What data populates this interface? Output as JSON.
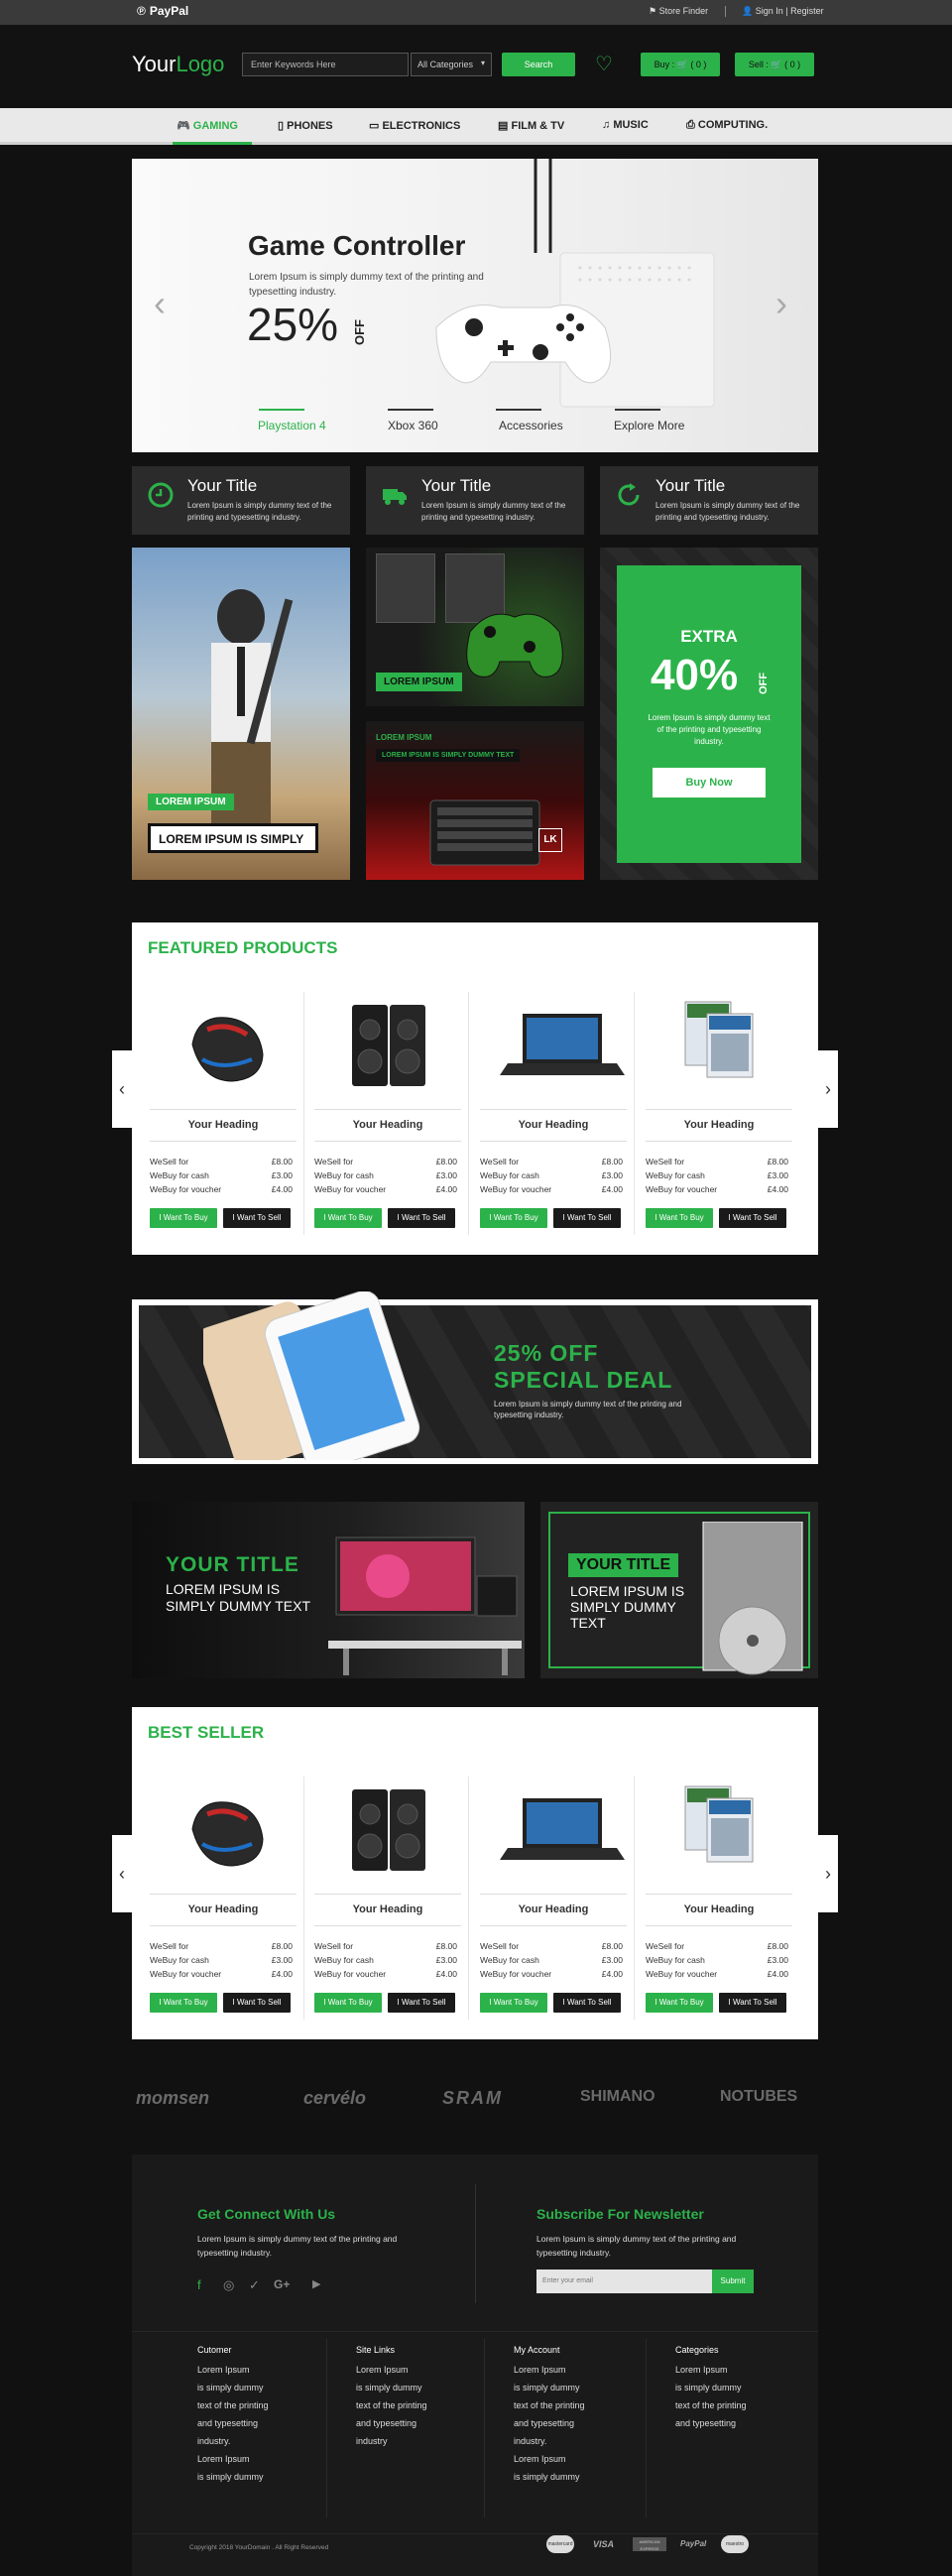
{
  "topbar": {
    "paypal": "PayPal",
    "store_finder": "Store Finder",
    "signin": "Sign In | Register"
  },
  "header": {
    "logo_a": "Your",
    "logo_b": "Logo",
    "search_placeholder": "Enter Keywords Here",
    "category": "All Categories",
    "search_btn": "Search",
    "buy_btn": "Buy : 🛒 ( 0 )",
    "sell_btn": "Sell : 🛒 ( 0 )"
  },
  "nav": {
    "items": [
      "GAMING",
      "PHONES",
      "ELECTRONICS",
      "FILM & TV",
      "MUSIC",
      "COMPUTING."
    ]
  },
  "hero": {
    "title": "Game Controller",
    "text": "Lorem Ipsum is simply dummy text of the printing and typesetting industry.",
    "percent": "25%",
    "off": "OFF",
    "tabs": [
      "Playstation 4",
      "Xbox 360",
      "Accessories",
      "Explore More"
    ]
  },
  "title_boxes": [
    {
      "title": "Your Title",
      "text": "Lorem Ipsum is simply dummy text of the printing and typesetting industry.",
      "icon": "clock-icon"
    },
    {
      "title": "Your Title",
      "text": "Lorem Ipsum is simply dummy text of the printing and typesetting industry.",
      "icon": "truck-icon"
    },
    {
      "title": "Your Title",
      "text": "Lorem Ipsum is simply dummy text of the printing and typesetting industry.",
      "icon": "refresh-icon"
    }
  ],
  "promo": {
    "pubg_tag": "LOREM IPSUM",
    "pubg_caption": "LOREM IPSUM IS SIMPLY",
    "ctrl_tag": "LOREM IPSUM",
    "kb_tag1": "LOREM IPSUM",
    "kb_tag2": "LOREM IPSUM IS SIMPLY DUMMY TEXT",
    "extra": "EXTRA",
    "extra_pct": "40%",
    "extra_off": "OFF",
    "extra_text": "Lorem Ipsum is simply dummy text of the printing and typesetting industry.",
    "buy_now": "Buy Now"
  },
  "featured": {
    "title": "FEATURED PRODUCTS",
    "products": [
      {
        "heading": "Your Heading",
        "rows": [
          [
            "WeSell for",
            "£8.00"
          ],
          [
            "WeBuy for cash",
            "£3.00"
          ],
          [
            "WeBuy for voucher",
            "£4.00"
          ]
        ],
        "buy": "I Want To Buy",
        "sell": "I Want To Sell",
        "img": "mouse"
      },
      {
        "heading": "Your Heading",
        "rows": [
          [
            "WeSell for",
            "£8.00"
          ],
          [
            "WeBuy for cash",
            "£3.00"
          ],
          [
            "WeBuy for voucher",
            "£4.00"
          ]
        ],
        "buy": "I Want To Buy",
        "sell": "I Want To Sell",
        "img": "speaker"
      },
      {
        "heading": "Your Heading",
        "rows": [
          [
            "WeSell for",
            "£8.00"
          ],
          [
            "WeBuy for cash",
            "£3.00"
          ],
          [
            "WeBuy for voucher",
            "£4.00"
          ]
        ],
        "buy": "I Want To Buy",
        "sell": "I Want To Sell",
        "img": "laptop"
      },
      {
        "heading": "Your Heading",
        "rows": [
          [
            "WeSell for",
            "£8.00"
          ],
          [
            "WeBuy for cash",
            "£3.00"
          ],
          [
            "WeBuy for voucher",
            "£4.00"
          ]
        ],
        "buy": "I Want To Buy",
        "sell": "I Want To Sell",
        "img": "game"
      }
    ]
  },
  "deal": {
    "line1": "25% OFF",
    "line2": "SPECIAL DEAL",
    "text": "Lorem Ipsum is simply dummy text of the printing and typesetting industry."
  },
  "banners": [
    {
      "title": "YOUR TITLE",
      "l1": "LOREM IPSUM IS",
      "l2": "SIMPLY DUMMY TEXT"
    },
    {
      "title": "YOUR TITLE",
      "l1": "LOREM IPSUM IS",
      "l2": "SIMPLY DUMMY",
      "l3": "TEXT"
    }
  ],
  "bestseller": {
    "title": "BEST SELLER",
    "products": [
      {
        "heading": "Your Heading",
        "rows": [
          [
            "WeSell for",
            "£8.00"
          ],
          [
            "WeBuy for cash",
            "£3.00"
          ],
          [
            "WeBuy for voucher",
            "£4.00"
          ]
        ],
        "buy": "I Want To Buy",
        "sell": "I Want To Sell",
        "img": "mouse"
      },
      {
        "heading": "Your Heading",
        "rows": [
          [
            "WeSell for",
            "£8.00"
          ],
          [
            "WeBuy for cash",
            "£3.00"
          ],
          [
            "WeBuy for voucher",
            "£4.00"
          ]
        ],
        "buy": "I Want To Buy",
        "sell": "I Want To Sell",
        "img": "speaker"
      },
      {
        "heading": "Your Heading",
        "rows": [
          [
            "WeSell for",
            "£8.00"
          ],
          [
            "WeBuy for cash",
            "£3.00"
          ],
          [
            "WeBuy for voucher",
            "£4.00"
          ]
        ],
        "buy": "I Want To Buy",
        "sell": "I Want To Sell",
        "img": "laptop"
      },
      {
        "heading": "Your Heading",
        "rows": [
          [
            "WeSell for",
            "£8.00"
          ],
          [
            "WeBuy for cash",
            "£3.00"
          ],
          [
            "WeBuy for voucher",
            "£4.00"
          ]
        ],
        "buy": "I Want To Buy",
        "sell": "I Want To Sell",
        "img": "game"
      }
    ]
  },
  "brands": [
    "momsen",
    "cervélo",
    "SRAM",
    "SHIMANO",
    "NOTUBES"
  ],
  "footer": {
    "connect_title": "Get Connect With Us",
    "connect_text": "Lorem Ipsum is simply dummy text of the printing and typesetting industry.",
    "news_title": "Subscribe For Newsletter",
    "news_text": "Lorem Ipsum is simply dummy text of the printing and typesetting industry.",
    "email_placeholder": "Enter your email",
    "submit": "Submit",
    "cols": [
      {
        "h": "Cutomer",
        "lines": [
          "Lorem Ipsum",
          "is simply dummy",
          "text of the printing",
          "and typesetting",
          "industry.",
          "Lorem Ipsum",
          "is simply dummy"
        ]
      },
      {
        "h": "Site Links",
        "lines": [
          "Lorem Ipsum",
          "is simply dummy",
          "text of the printing",
          "and typesetting",
          "industry"
        ]
      },
      {
        "h": "My Account",
        "lines": [
          "Lorem Ipsum",
          "is simply dummy",
          "text of the printing",
          "and typesetting",
          "industry.",
          "Lorem Ipsum",
          "is simply dummy"
        ]
      },
      {
        "h": "Categories",
        "lines": [
          "Lorem Ipsum",
          "is simply dummy",
          "text of the printing",
          "and typesetting"
        ]
      }
    ],
    "copyright": "Copyright 2018 YourDomain . All Right Reserved",
    "payments": [
      "mastercard",
      "VISA",
      "AMERICAN EXPRESS",
      "PayPal",
      "maestro"
    ]
  },
  "colors": {
    "accent": "#2cb24a",
    "dark": "#111111",
    "panel": "#2b2b2b"
  }
}
